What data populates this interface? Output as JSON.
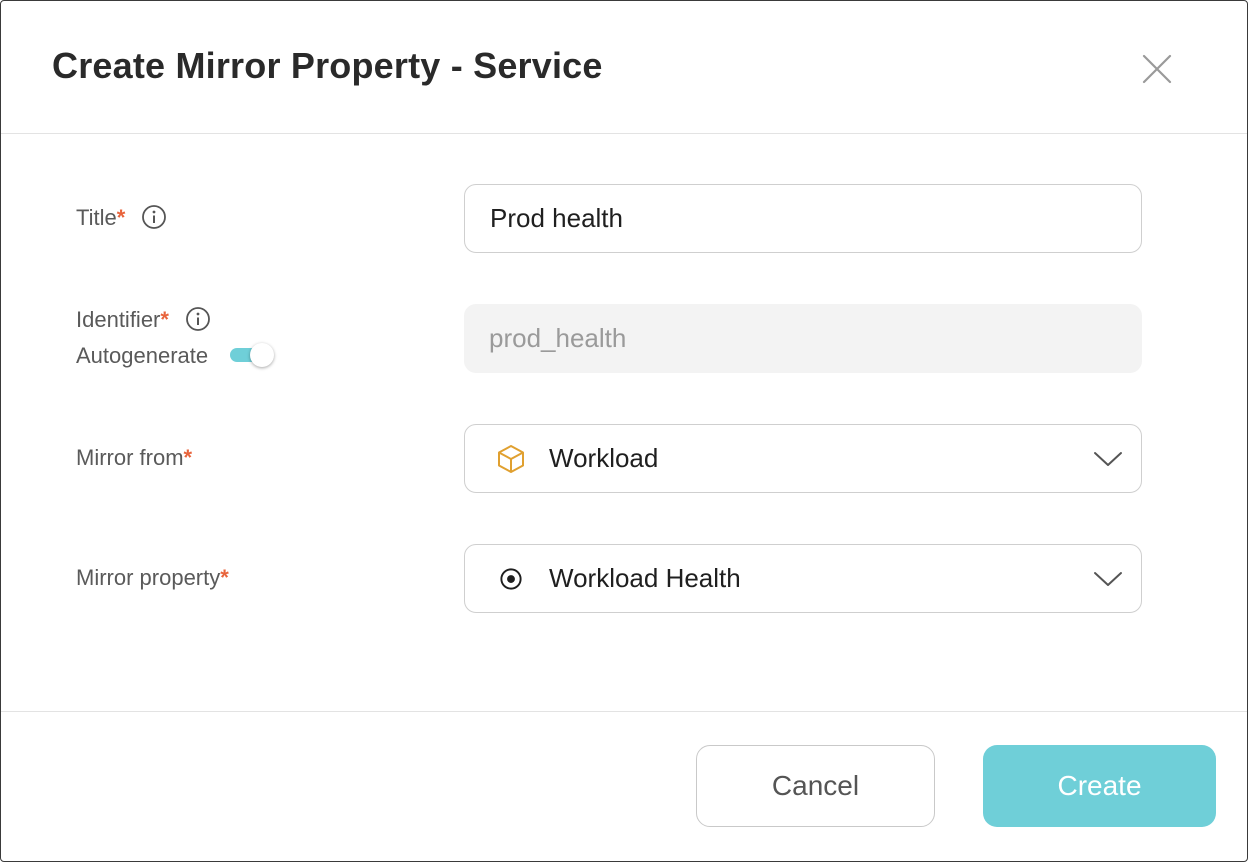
{
  "dialog": {
    "title": "Create Mirror Property - Service",
    "close_icon": "close-icon"
  },
  "form": {
    "title_field": {
      "label": "Title",
      "required_mark": "*",
      "value": "Prod health",
      "info_icon": "info-icon"
    },
    "identifier_field": {
      "label": "Identifier",
      "required_mark": "*",
      "value": "prod_health",
      "info_icon": "info-icon",
      "autogenerate_label": "Autogenerate",
      "autogenerate_on": true
    },
    "mirror_from": {
      "label": "Mirror from",
      "required_mark": "*",
      "value": "Workload",
      "icon": "cube-icon"
    },
    "mirror_property": {
      "label": "Mirror property",
      "required_mark": "*",
      "value": "Workload Health",
      "icon": "radio-dot-icon"
    }
  },
  "footer": {
    "cancel_label": "Cancel",
    "create_label": "Create"
  },
  "colors": {
    "accent": "#6fcfd8",
    "required": "#e8643c",
    "cube_icon": "#e0a030"
  }
}
